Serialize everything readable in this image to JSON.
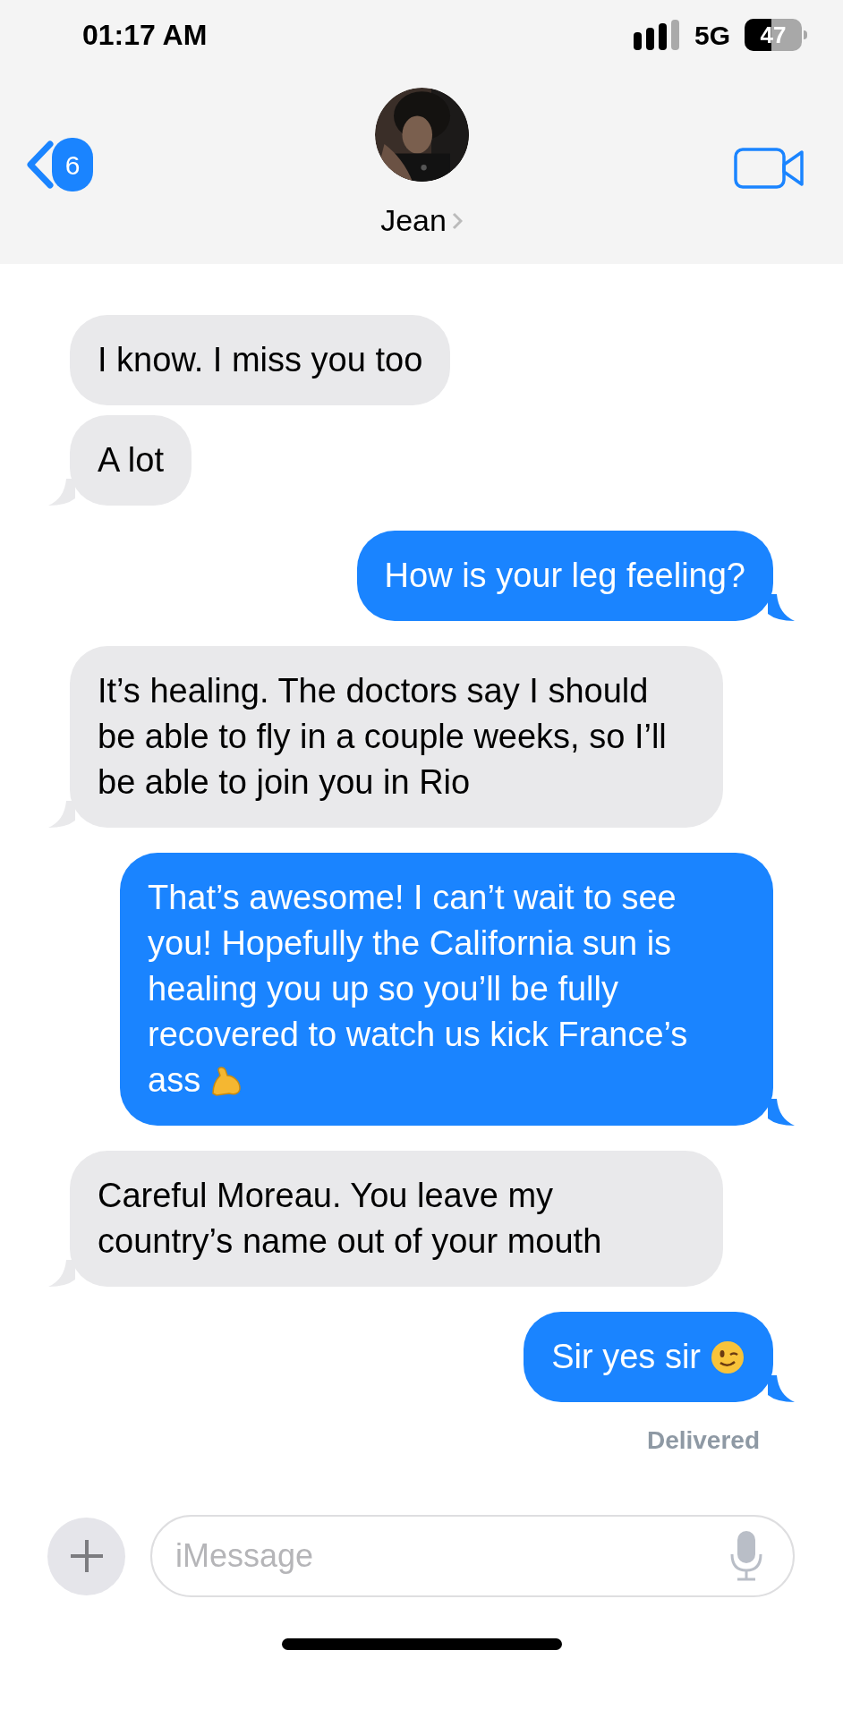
{
  "status_bar": {
    "time": "01:17 AM",
    "network": "5G",
    "battery": "47"
  },
  "header": {
    "back_badge": "6",
    "contact_name": "Jean"
  },
  "messages": [
    {
      "kind": "received",
      "text": "I know. I miss you too"
    },
    {
      "kind": "received",
      "text": "A lot"
    },
    {
      "kind": "sent",
      "text": "How is your leg feeling?"
    },
    {
      "kind": "received",
      "text": "It’s healing. The doctors say I should be able to fly in a couple weeks, so I’ll be able to join you in Rio"
    },
    {
      "kind": "sent",
      "text": "That’s awesome! I can’t wait to see you! Hopefully the California sun is healing you up so you’ll be fully recovered to watch us kick France’s ass",
      "emoji": {
        "kind": "flexed-arm"
      }
    },
    {
      "kind": "received",
      "text": "Careful Moreau. You leave my country’s name out of your mouth"
    },
    {
      "kind": "sent",
      "text": "Sir yes sir",
      "emoji": {
        "kind": "winking-face"
      }
    }
  ],
  "delivery_status": "Delivered",
  "composer": {
    "placeholder": "iMessage"
  }
}
